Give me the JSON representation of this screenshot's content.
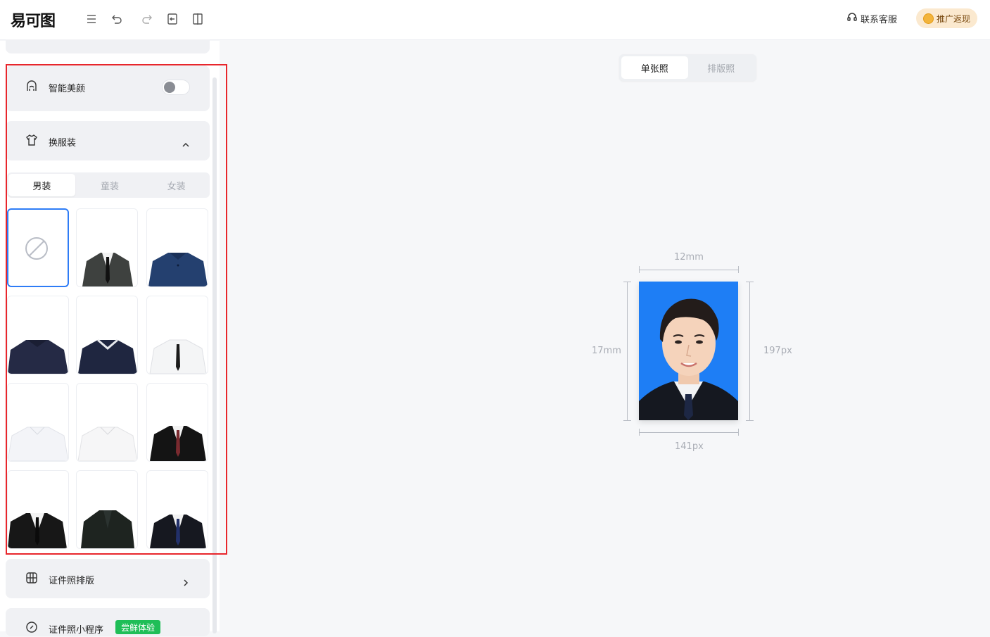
{
  "topbar": {
    "logo": "易可图",
    "tools": [
      "menu-icon",
      "undo-icon",
      "redo-icon",
      "import-icon",
      "compare-icon"
    ],
    "support_label": "联系客服",
    "promo_label": "推广返现"
  },
  "sidebar": {
    "beauty_label": "智能美颜",
    "beauty_enabled": false,
    "clothing_label": "换服装",
    "clothing_tabs": [
      "男装",
      "童装",
      "女装"
    ],
    "clothing_active_tab": "男装",
    "layout_label": "证件照排版",
    "miniprogram_label": "证件照小程序",
    "miniprogram_badge": "尝鲜体验",
    "outfits": [
      "none",
      "dark-gray-suit-black-tie",
      "navy-polo",
      "navy-polo-dark",
      "navy-polo-white-collar",
      "white-shirt-black-tie",
      "white-shirt",
      "white-shirt-2",
      "black-suit-red-tie",
      "black-suit-black-tie",
      "black-suit-dark",
      "black-suit-blue-tie"
    ]
  },
  "canvas": {
    "modes": [
      "单张照",
      "排版照"
    ],
    "active_mode": "单张照",
    "width_mm": "12mm",
    "height_mm": "17mm",
    "width_px": "141px",
    "height_px": "197px",
    "background_color": "#1e7ef5"
  }
}
